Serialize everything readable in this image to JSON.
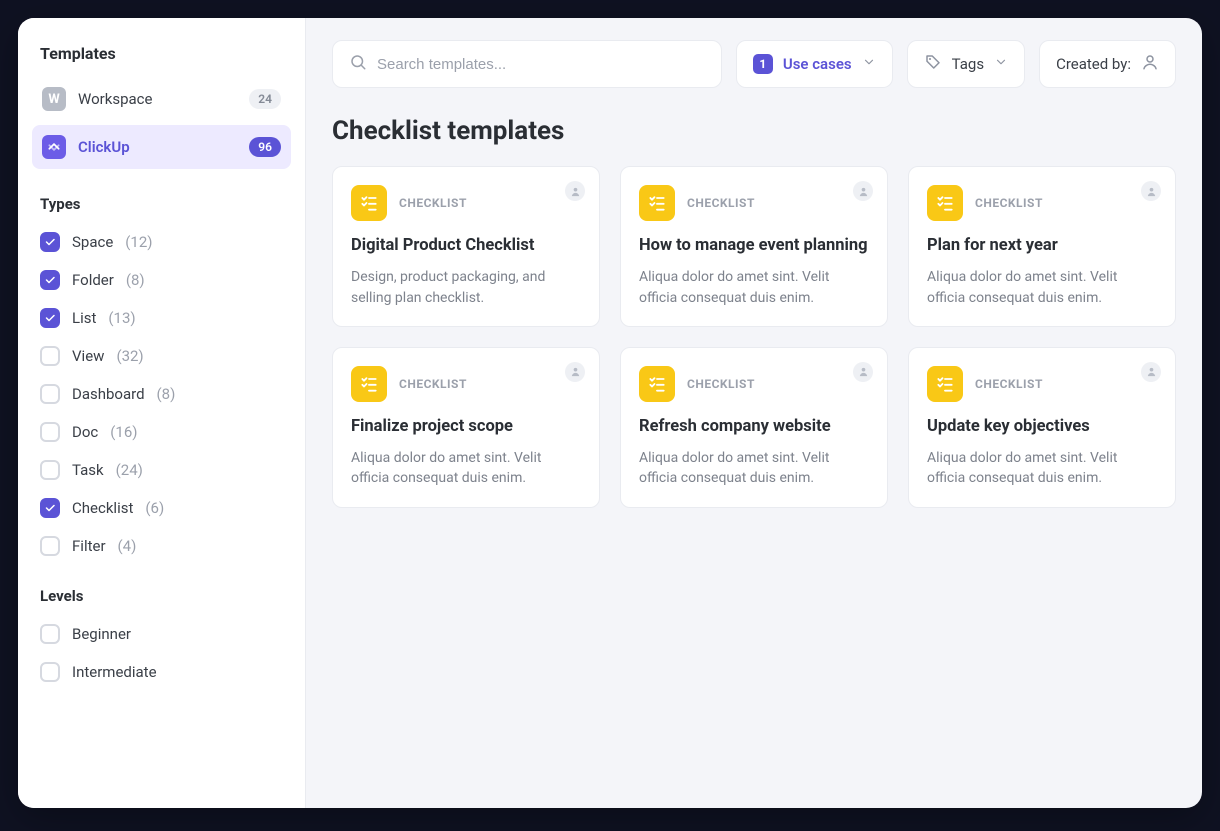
{
  "sidebar": {
    "title": "Templates",
    "sources": [
      {
        "icon": "W",
        "label": "Workspace",
        "count": "24",
        "active": false
      },
      {
        "icon": "cu",
        "label": "ClickUp",
        "count": "96",
        "active": true
      }
    ],
    "types_title": "Types",
    "types": [
      {
        "label": "Space",
        "count": "(12)",
        "checked": true
      },
      {
        "label": "Folder",
        "count": "(8)",
        "checked": true
      },
      {
        "label": "List",
        "count": "(13)",
        "checked": true
      },
      {
        "label": "View",
        "count": "(32)",
        "checked": false
      },
      {
        "label": "Dashboard",
        "count": "(8)",
        "checked": false
      },
      {
        "label": "Doc",
        "count": "(16)",
        "checked": false
      },
      {
        "label": "Task",
        "count": "(24)",
        "checked": false
      },
      {
        "label": "Checklist",
        "count": "(6)",
        "checked": true
      },
      {
        "label": "Filter",
        "count": "(4)",
        "checked": false
      }
    ],
    "levels_title": "Levels",
    "levels": [
      {
        "label": "Beginner",
        "checked": false
      },
      {
        "label": "Intermediate",
        "checked": false
      }
    ]
  },
  "topbar": {
    "search_placeholder": "Search templates...",
    "usecases": {
      "count": "1",
      "label": "Use cases"
    },
    "tags_label": "Tags",
    "createdby_label": "Created by:"
  },
  "main": {
    "title": "Checklist templates",
    "cards": [
      {
        "tag": "CHECKLIST",
        "title": "Digital Product Checklist",
        "desc": "Design, product packaging, and selling plan checklist."
      },
      {
        "tag": "CHECKLIST",
        "title": "How to manage event planning",
        "desc": "Aliqua dolor do amet sint. Velit officia consequat duis enim."
      },
      {
        "tag": "CHECKLIST",
        "title": "Plan for next year",
        "desc": "Aliqua dolor do amet sint. Velit officia consequat duis enim."
      },
      {
        "tag": "CHECKLIST",
        "title": "Finalize project scope",
        "desc": "Aliqua dolor do amet sint. Velit officia consequat duis enim."
      },
      {
        "tag": "CHECKLIST",
        "title": "Refresh company website",
        "desc": "Aliqua dolor do amet sint. Velit officia consequat duis enim."
      },
      {
        "tag": "CHECKLIST",
        "title": "Update key objectives",
        "desc": "Aliqua dolor do amet sint. Velit officia consequat duis enim."
      }
    ]
  }
}
